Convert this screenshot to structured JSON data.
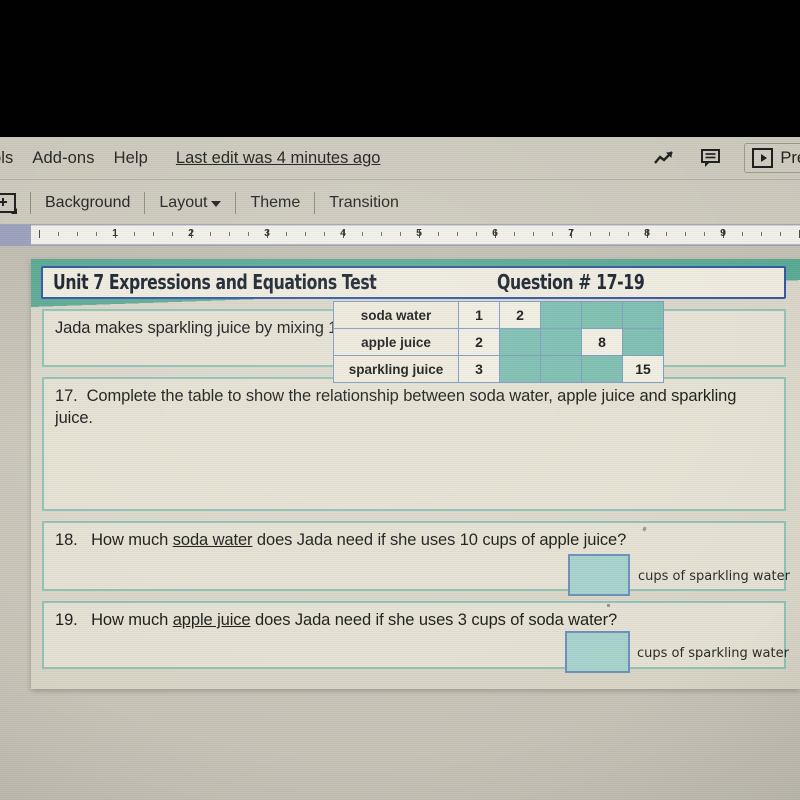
{
  "app": {
    "menubar": {
      "items": [
        "ols",
        "Add-ons",
        "Help"
      ],
      "last_edit": "Last edit was 4 minutes ago",
      "icons": [
        "explore-icon",
        "comment-icon"
      ],
      "present_label": "Pre"
    },
    "toolbar": {
      "new_slide_icon": "new-slide-icon",
      "items": [
        "Background",
        "Layout",
        "Theme",
        "Transition"
      ],
      "layout_has_caret": true
    },
    "ruler": {
      "numbers": [
        "1",
        "2",
        "3",
        "4",
        "5",
        "6",
        "7",
        "8",
        "9"
      ]
    }
  },
  "slide": {
    "title": {
      "main": "Unit 7 Expressions and Equations Test",
      "question_number": "Question # 17-19"
    },
    "stem": "Jada makes sparkling juice by mixing 1 cup of soda water with 2 cups of apple juice.",
    "q17": {
      "number": "17.",
      "text_before": "Complete the table to show the relationship between soda water, apple juice and sparkling juice.",
      "table": {
        "rows": [
          {
            "label": "soda water",
            "cells": [
              "1",
              "2",
              "",
              "",
              ""
            ]
          },
          {
            "label": "apple juice",
            "cells": [
              "2",
              "",
              "",
              "8",
              ""
            ]
          },
          {
            "label": "sparkling juice",
            "cells": [
              "3",
              "",
              "",
              "",
              "15"
            ]
          }
        ]
      }
    },
    "q18": {
      "number": "18.",
      "part1": "How much ",
      "underlined": "soda water",
      "part2": " does Jada need if she uses 10 cups of apple juice?",
      "answer_value": "",
      "unit_label": "cups of sparkling water"
    },
    "q19": {
      "number": "19.",
      "part1": "How much ",
      "underlined": "apple juice",
      "part2": " does Jada need if she uses 3 cups of soda water?",
      "answer_value": "",
      "unit_label": "cups of sparkling water"
    }
  },
  "colors": {
    "slide_band": "#58a992",
    "slide_body": "#d9d5c7",
    "title_border": "#2f55a4",
    "box_border": "#8fc4b6",
    "table_teal": "#7cbfb0",
    "table_border": "#7c9cc4",
    "answer_fill": "#a7d3cd",
    "answer_border": "#6c8fbb",
    "chrome": "#cdc9bd",
    "ruler_band": "#9aa0bc"
  }
}
